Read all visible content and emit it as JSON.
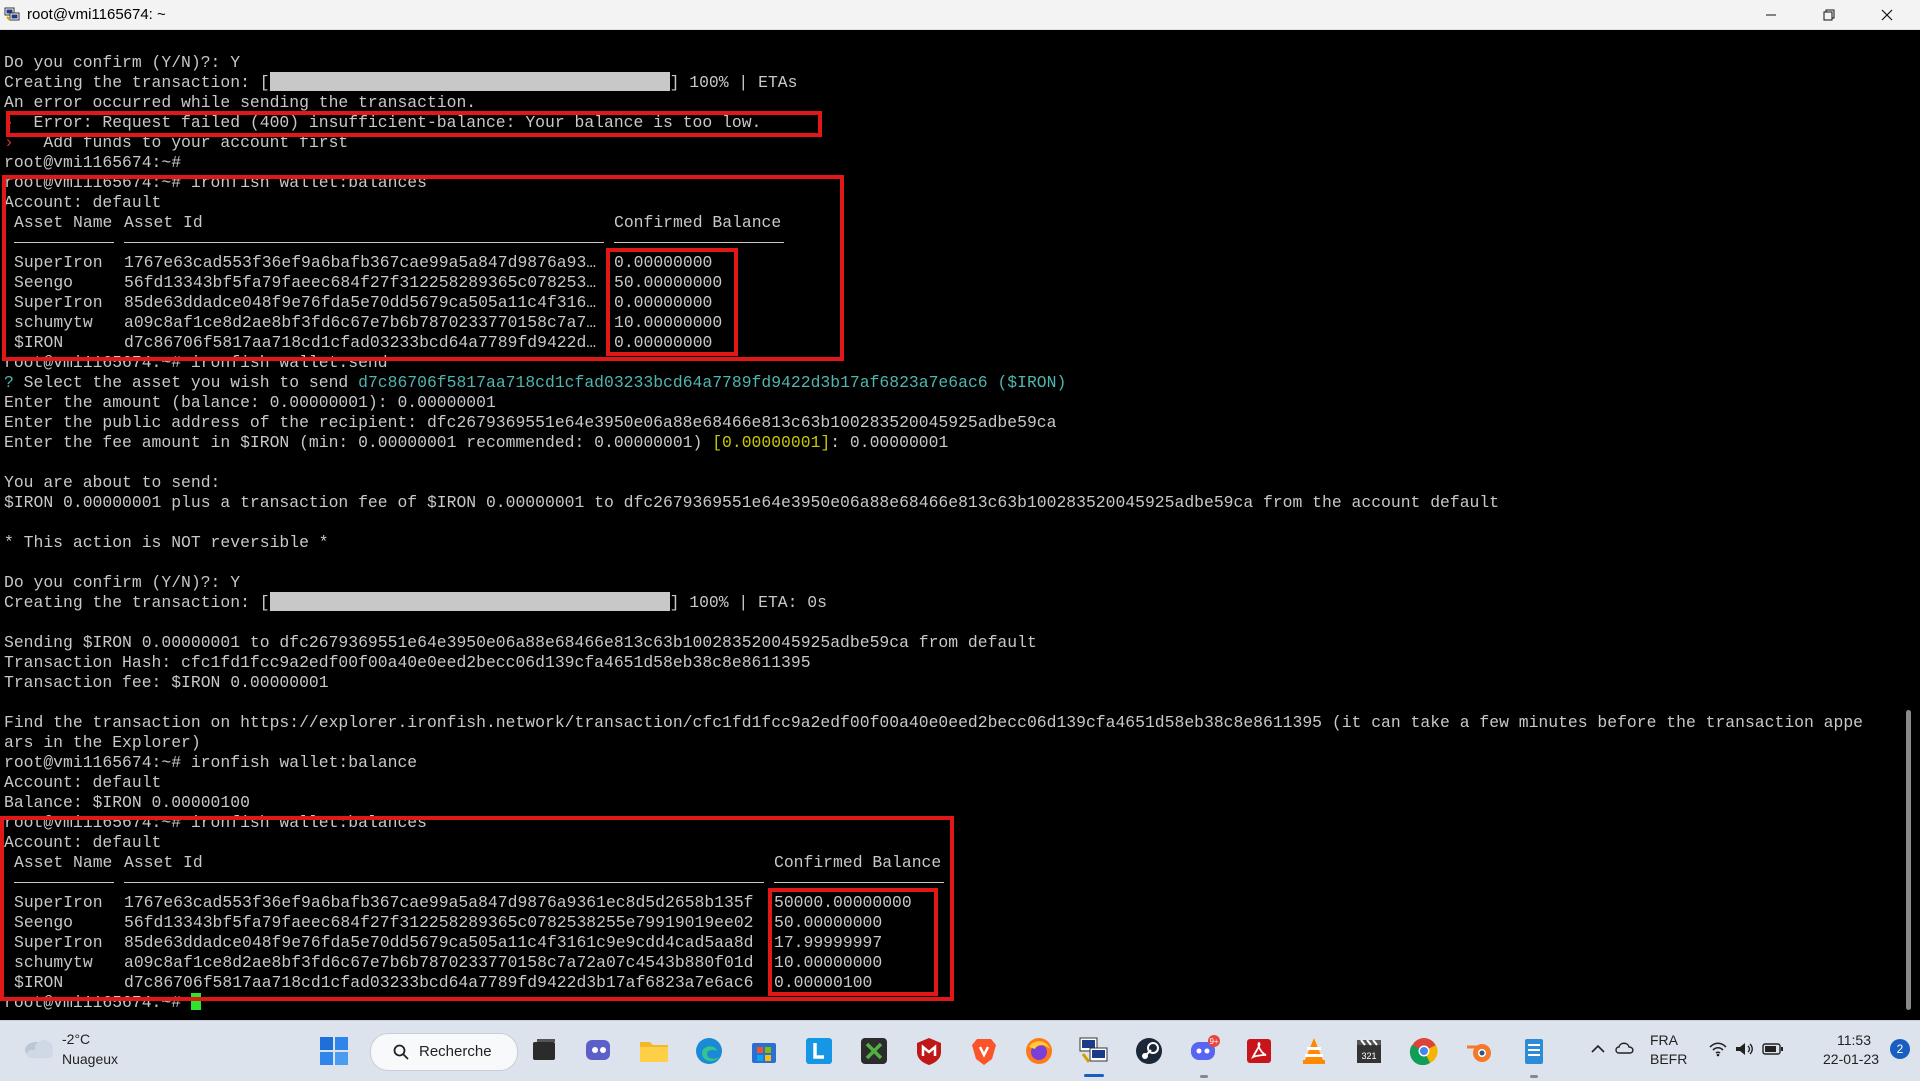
{
  "window": {
    "title": "root@vmi1165674: ~",
    "controls": {
      "minimize": "minimize",
      "maximize": "restore",
      "close": "close"
    }
  },
  "terminal": {
    "lines": {
      "l1": "Do you confirm (Y/N)?: Y",
      "l2_pre": "Creating the transaction: [",
      "l2_post": "] 100% | ETAs",
      "l3": "An error occurred while sending the transaction.",
      "l4_arrow": "›",
      "l4": "  Error: Request failed (400) insufficient-balance: Your balance is too low.",
      "l5_arrow": "›",
      "l5": "   Add funds to your account first",
      "l6": "root@vmi1165674:~#",
      "l7": "root@vmi1165674:~# ironfish wallet:balances",
      "l8": "Account: default",
      "l17": "root@vmi1165674:~# ironfish wallet:send",
      "l18_q": "?",
      "l18_text": " Select the asset you wish to send ",
      "l18_value": "d7c86706f5817aa718cd1cfad03233bcd64a7789fd9422d3b17af6823a7e6ac6 ($IRON)",
      "l19": "Enter the amount (balance: 0.00000001): 0.00000001",
      "l20": "Enter the public address of the recipient: dfc2679369551e64e3950e06a88e68466e813c63b100283520045925adbe59ca",
      "l21_pre": "Enter the fee amount in $IRON (min: 0.00000001 recommended: 0.00000001) ",
      "l21_default": "[0.00000001]",
      "l21_post": ": 0.00000001",
      "l23": "You are about to send:",
      "l24": "$IRON 0.00000001 plus a transaction fee of $IRON 0.00000001 to dfc2679369551e64e3950e06a88e68466e813c63b100283520045925adbe59ca from the account default",
      "l26": "* This action is NOT reversible *",
      "l28": "Do you confirm (Y/N)?: Y",
      "l29_pre": "Creating the transaction: [",
      "l29_post": "] 100% | ETA: 0s",
      "l31": "Sending $IRON 0.00000001 to dfc2679369551e64e3950e06a88e68466e813c63b100283520045925adbe59ca from default",
      "l32": "Transaction Hash: cfc1fd1fcc9a2edf00f00a40e0eed2becc06d139cfa4651d58eb38c8e8611395",
      "l33": "Transaction fee: $IRON 0.00000001",
      "l35": "Find the transaction on https://explorer.ironfish.network/transaction/cfc1fd1fcc9a2edf00f00a40e0eed2becc06d139cfa4651d58eb38c8e8611395 (it can take a few minutes before the transaction appe",
      "l36": "ars in the Explorer)",
      "l37": "root@vmi1165674:~# ironfish wallet:balance",
      "l38": "Account: default",
      "l39": "Balance: $IRON 0.00000100",
      "l40": "root@vmi1165674:~# ironfish wallet:balances",
      "l41": "Account: default",
      "l50": "root@vmi1165674:~# "
    },
    "table1": {
      "headers": {
        "name": "Asset Name",
        "id": "Asset Id",
        "balance": "Confirmed Balance"
      },
      "rows": [
        {
          "name": "SuperIron",
          "id": "1767e63cad553f36ef9a6bafb367cae99a5a847d9876a93…",
          "balance": "0.00000000"
        },
        {
          "name": "Seengo",
          "id": "56fd13343bf5fa79faeec684f27f312258289365c078253…",
          "balance": "50.00000000"
        },
        {
          "name": "SuperIron",
          "id": "85de63ddadce048f9e76fda5e70dd5679ca505a11c4f316…",
          "balance": "0.00000000"
        },
        {
          "name": "schumytw",
          "id": "a09c8af1ce8d2ae8bf3fd6c67e7b6b7870233770158c7a7…",
          "balance": "10.00000000"
        },
        {
          "name": "$IRON",
          "id": "d7c86706f5817aa718cd1cfad03233bcd64a7789fd9422d…",
          "balance": "0.00000000"
        }
      ]
    },
    "table2": {
      "headers": {
        "name": "Asset Name",
        "id": "Asset Id",
        "balance": "Confirmed Balance"
      },
      "rows": [
        {
          "name": "SuperIron",
          "id": "1767e63cad553f36ef9a6bafb367cae99a5a847d9876a9361ec8d5d2658b135f",
          "balance": "50000.00000000"
        },
        {
          "name": "Seengo",
          "id": "56fd13343bf5fa79faeec684f27f312258289365c0782538255e79919019ee02",
          "balance": "50.00000000"
        },
        {
          "name": "SuperIron",
          "id": "85de63ddadce048f9e76fda5e70dd5679ca505a11c4f3161c9e9cdd4cad5aa8d",
          "balance": "17.99999997"
        },
        {
          "name": "schumytw",
          "id": "a09c8af1ce8d2ae8bf3fd6c67e7b6b7870233770158c7a72a07c4543b880f01d",
          "balance": "10.00000000"
        },
        {
          "name": "$IRON",
          "id": "d7c86706f5817aa718cd1cfad03233bcd64a7789fd9422d3b17af6823a7e6ac6",
          "balance": "0.00000100"
        }
      ]
    },
    "colors": {
      "text": "#c8c8c8",
      "prompt_question": "#4fb5b0",
      "default_hint": "#c8c800",
      "highlight_box": "#e01818",
      "cursor": "#2ee52e"
    }
  },
  "taskbar": {
    "weather": {
      "temp": "-2°C",
      "condition": "Nuageux",
      "icon": "cloud-icon"
    },
    "search_label": "Recherche",
    "apps": [
      "start-icon",
      "search-icon",
      "task-view-icon",
      "chat-icon",
      "file-explorer-icon",
      "edge-icon",
      "store-icon",
      "l-app-icon",
      "xbox-icon",
      "mcafee-icon",
      "brave-icon",
      "firefox-icon",
      "putty-icon",
      "steam-icon",
      "discord-icon",
      "acrobat-icon",
      "vlc-icon",
      "clapper-icon",
      "chrome-icon",
      "blender-icon",
      "notepad-icon"
    ],
    "discord_badge": "9+",
    "tray": {
      "lang_top": "FRA",
      "lang_bottom": "BEFR",
      "time": "11:53",
      "date": "22-01-23",
      "notifications": "2"
    }
  }
}
